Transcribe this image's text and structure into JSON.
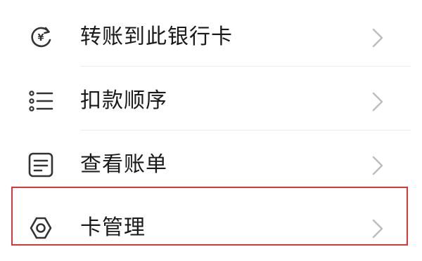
{
  "menu": {
    "items": [
      {
        "label": "转账到此银行卡",
        "icon": "yuan-transfer-icon"
      },
      {
        "label": "扣款顺序",
        "icon": "list-icon"
      },
      {
        "label": "查看账单",
        "icon": "bill-icon"
      },
      {
        "label": "卡管理",
        "icon": "gear-icon"
      }
    ],
    "highlighted_index": 3,
    "highlight_color": "#d9363e"
  }
}
